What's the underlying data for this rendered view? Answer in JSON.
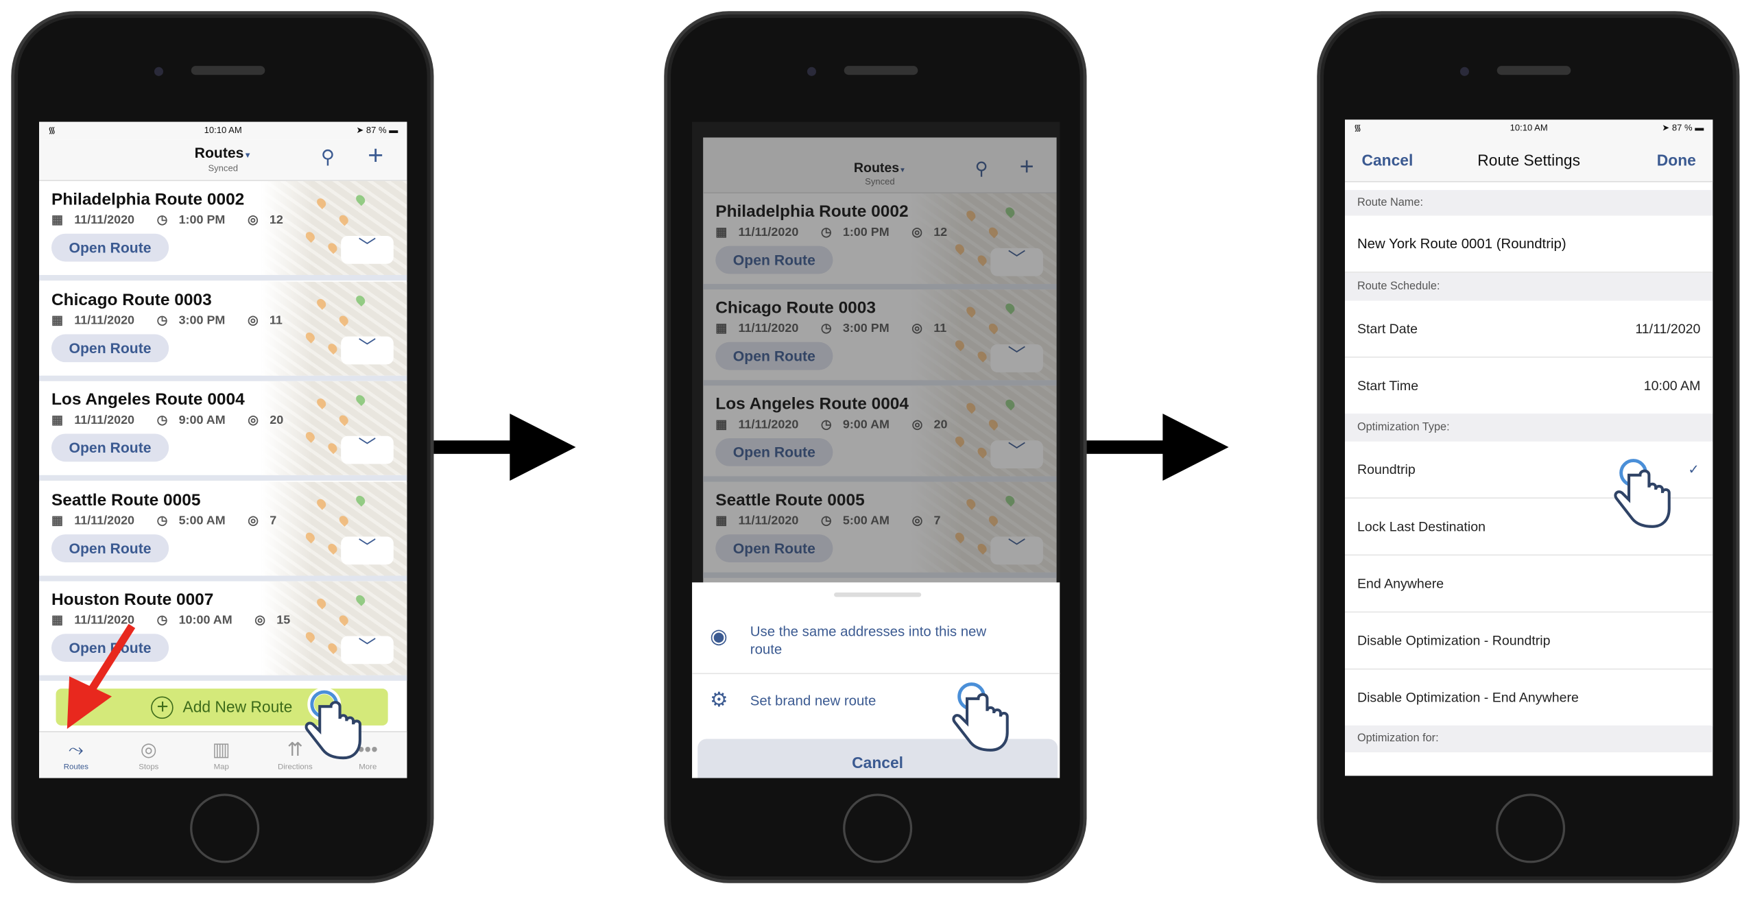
{
  "status_bar": {
    "time": "10:10 AM",
    "battery": "87 %"
  },
  "screen1": {
    "nav": {
      "title": "Routes",
      "subtitle": "Synced"
    },
    "routes": [
      {
        "name": "Philadelphia Route 0002",
        "date": "11/11/2020",
        "time": "1:00 PM",
        "stops": "12"
      },
      {
        "name": "Chicago Route 0003",
        "date": "11/11/2020",
        "time": "3:00 PM",
        "stops": "11"
      },
      {
        "name": "Los Angeles Route 0004",
        "date": "11/11/2020",
        "time": "9:00 AM",
        "stops": "20"
      },
      {
        "name": "Seattle Route 0005",
        "date": "11/11/2020",
        "time": "5:00 AM",
        "stops": "7"
      },
      {
        "name": "Houston Route 0007",
        "date": "11/11/2020",
        "time": "10:00 AM",
        "stops": "15"
      }
    ],
    "open_label": "Open Route",
    "add_button": "Add New Route",
    "tabs": [
      "Routes",
      "Stops",
      "Map",
      "Directions",
      "More"
    ],
    "active_tab": "Routes"
  },
  "screen2": {
    "routes": [
      {
        "name": "Philadelphia Route 0002",
        "date": "11/11/2020",
        "time": "1:00 PM",
        "stops": "12"
      },
      {
        "name": "Chicago Route 0003",
        "date": "11/11/2020",
        "time": "3:00 PM",
        "stops": "11"
      },
      {
        "name": "Los Angeles Route 0004",
        "date": "11/11/2020",
        "time": "9:00 AM",
        "stops": "20"
      },
      {
        "name": "Seattle Route 0005",
        "date": "11/11/2020",
        "time": "5:00 AM",
        "stops": "7"
      }
    ],
    "sheet": {
      "option1": "Use the same addresses into this new route",
      "option2": "Set brand new route",
      "cancel": "Cancel"
    }
  },
  "screen3": {
    "nav": {
      "cancel": "Cancel",
      "title": "Route Settings",
      "done": "Done"
    },
    "route_name_header": "Route Name:",
    "route_name": "New York Route 0001 (Roundtrip)",
    "schedule_header": "Route Schedule:",
    "start_date_label": "Start Date",
    "start_date": "11/11/2020",
    "start_time_label": "Start Time",
    "start_time": "10:00 AM",
    "optimization_header": "Optimization Type:",
    "optimization_options": [
      "Roundtrip",
      "Lock Last Destination",
      "End Anywhere",
      "Disable Optimization - Roundtrip",
      "Disable Optimization - End Anywhere"
    ],
    "selected_option": "Roundtrip",
    "optimization_for_header": "Optimization for:"
  },
  "colors": {
    "accent": "#3b5a91",
    "add_button": "#d4e97a",
    "add_text": "#3d6b1a",
    "pointer_arrow": "#e8281e"
  }
}
